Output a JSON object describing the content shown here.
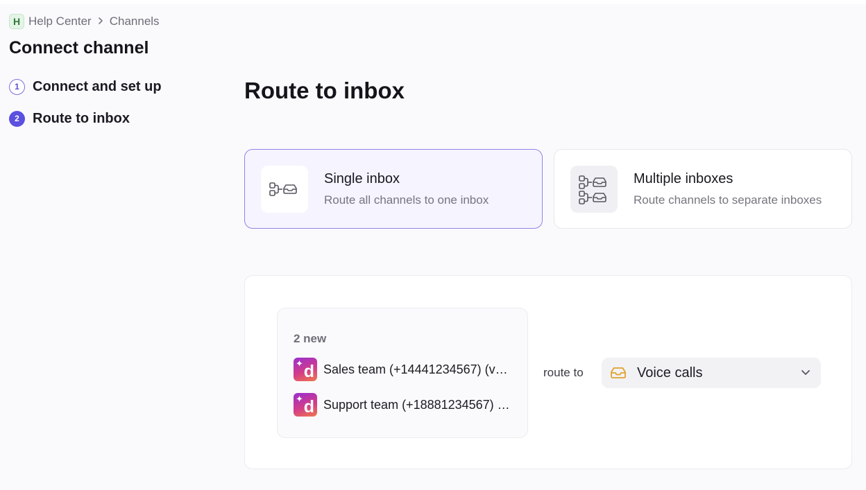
{
  "breadcrumb": {
    "workspace_initial": "H",
    "workspace": "Help Center",
    "separator": ">",
    "current": "Channels"
  },
  "page_title": "Connect channel",
  "steps": [
    {
      "number": "1",
      "label": "Connect and set up"
    },
    {
      "number": "2",
      "label": "Route to inbox"
    }
  ],
  "main": {
    "title": "Route to inbox",
    "options": [
      {
        "title": "Single inbox",
        "subtitle": "Route all channels to one inbox",
        "selected": true,
        "icon": "single-route-icon"
      },
      {
        "title": "Multiple inboxes",
        "subtitle": "Route channels to separate inboxes",
        "selected": false,
        "icon": "multi-route-icon"
      }
    ],
    "routing": {
      "new_count_label": "2 new",
      "channels": [
        {
          "name": "Sales team (+14441234567) (v…",
          "icon": "dialpad-logo-icon"
        },
        {
          "name": "Support team (+18881234567) …",
          "icon": "dialpad-logo-icon"
        }
      ],
      "route_to_label": "route to",
      "selected_inbox": "Voice calls",
      "inbox_icon": "inbox-icon",
      "colors": {
        "inbox_icon": "#e0a22e",
        "accent": "#5b50e0"
      }
    }
  }
}
